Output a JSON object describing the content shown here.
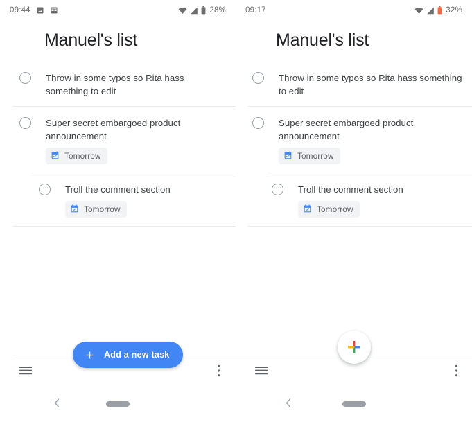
{
  "app": {
    "list_title": "Manuel's list"
  },
  "panels": [
    {
      "id": "left",
      "statusbar": {
        "time": "09:44",
        "notification_icons": [
          "image-icon",
          "article-icon"
        ],
        "wifi_icon": "wifi-icon",
        "signal_icon": "signal-icon",
        "battery_icon": "battery-icon",
        "battery_percent": "28%",
        "battery_color": "#6d6d6d"
      },
      "fab": {
        "type": "extended",
        "label": "Add a new task",
        "icon": "plus-icon",
        "background": "#4285f4",
        "text_color": "#ffffff"
      }
    },
    {
      "id": "right",
      "statusbar": {
        "time": "09:17",
        "notification_icons": [],
        "wifi_icon": "wifi-icon",
        "signal_icon": "signal-icon",
        "battery_icon": "battery-low-icon",
        "battery_percent": "32%",
        "battery_color": "#ea6a47"
      },
      "fab": {
        "type": "round",
        "label": "",
        "icon": "google-plus-icon",
        "background": "#ffffff",
        "text_color": "#ffffff"
      }
    }
  ],
  "tasks": [
    {
      "title": "Throw in some typos so Rita hass something to edit",
      "checked": false,
      "indent": false,
      "chip": null
    },
    {
      "title": "Super secret embargoed product announcement",
      "checked": false,
      "indent": false,
      "chip": {
        "label": "Tomorrow",
        "icon": "calendar-check-icon",
        "icon_color": "#4285f4"
      }
    },
    {
      "title": "Troll the comment section",
      "checked": false,
      "indent": true,
      "chip": {
        "label": "Tomorrow",
        "icon": "calendar-check-icon",
        "icon_color": "#4285f4"
      }
    }
  ],
  "bottombar": {
    "menu_icon": "hamburger-menu-icon",
    "overflow_icon": "more-vert-icon"
  },
  "sysnav": {
    "back_icon": "chevron-left-icon",
    "home_pill": "home-pill"
  },
  "colors": {
    "accent": "#4285f4",
    "divider": "#e8eaed",
    "text_primary": "#202124",
    "text_secondary": "#3c4043",
    "text_muted": "#5f6368",
    "chip_bg": "#f1f3f4",
    "google_red": "#ea4335",
    "google_yellow": "#fbbc05",
    "google_green": "#34a853",
    "google_blue": "#4285f4"
  }
}
